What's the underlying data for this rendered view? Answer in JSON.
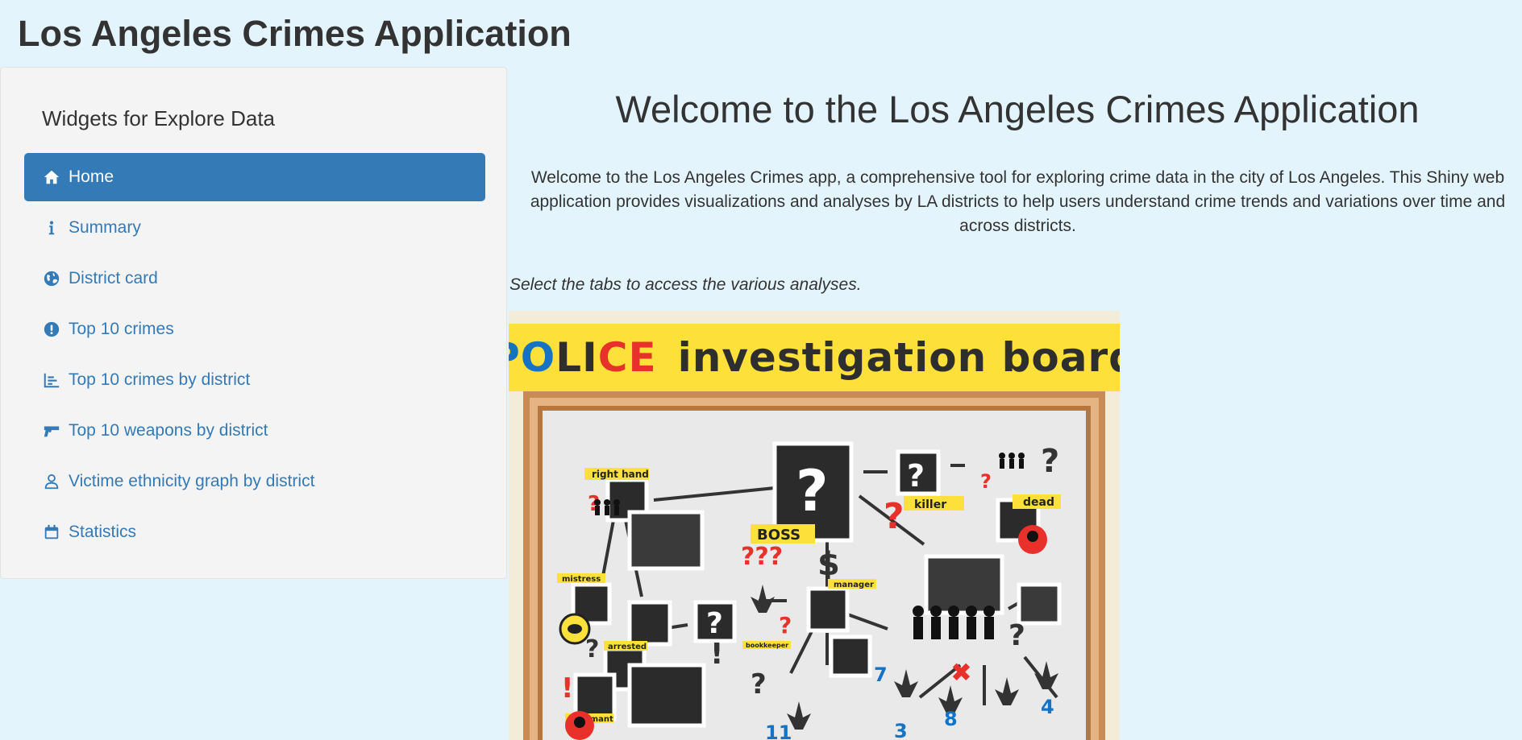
{
  "app": {
    "title": "Los Angeles Crimes Application"
  },
  "sidebar": {
    "heading": "Widgets for Explore Data",
    "items": [
      {
        "label": "Home",
        "icon": "home-icon",
        "active": true
      },
      {
        "label": "Summary",
        "icon": "info-icon",
        "active": false
      },
      {
        "label": "District card",
        "icon": "globe-icon",
        "active": false
      },
      {
        "label": "Top 10 crimes",
        "icon": "exclamation-circle-icon",
        "active": false
      },
      {
        "label": "Top 10 crimes by district",
        "icon": "bar-chart-icon",
        "active": false
      },
      {
        "label": "Top 10 weapons by district",
        "icon": "gun-icon",
        "active": false
      },
      {
        "label": "Victime ethnicity graph by district",
        "icon": "user-icon",
        "active": false
      },
      {
        "label": "Statistics",
        "icon": "calendar-icon",
        "active": false
      }
    ]
  },
  "main": {
    "heading": "Welcome to the Los Angeles Crimes Application",
    "intro": "Welcome to the Los Angeles Crimes app, a comprehensive tool for exploring crime data in the city of Los Angeles. This Shiny web application provides visualizations and analyses by LA districts to help users understand crime trends and variations over time and across districts.",
    "tabs_hint": "Select the tabs to access the various analyses.",
    "image": {
      "banner_word1": "POLICE",
      "banner_word2": "investigation board",
      "labels": {
        "boss": "BOSS",
        "killer": "killer",
        "dead": "dead",
        "right_hand": "right hand",
        "mistress": "mistress",
        "manager": "manager",
        "bookkeeper": "bookkeeper",
        "arrested": "arrested",
        "informant": "informant"
      },
      "numbers": [
        "7",
        "3",
        "8",
        "4",
        "11"
      ]
    }
  },
  "colors": {
    "page_bg": "#e4f4fc",
    "sidebar_bg": "#f4f4f4",
    "accent": "#337ab7",
    "banner_yellow": "#fde13a",
    "police_blue": "#1673c3",
    "police_red": "#e8312a"
  }
}
